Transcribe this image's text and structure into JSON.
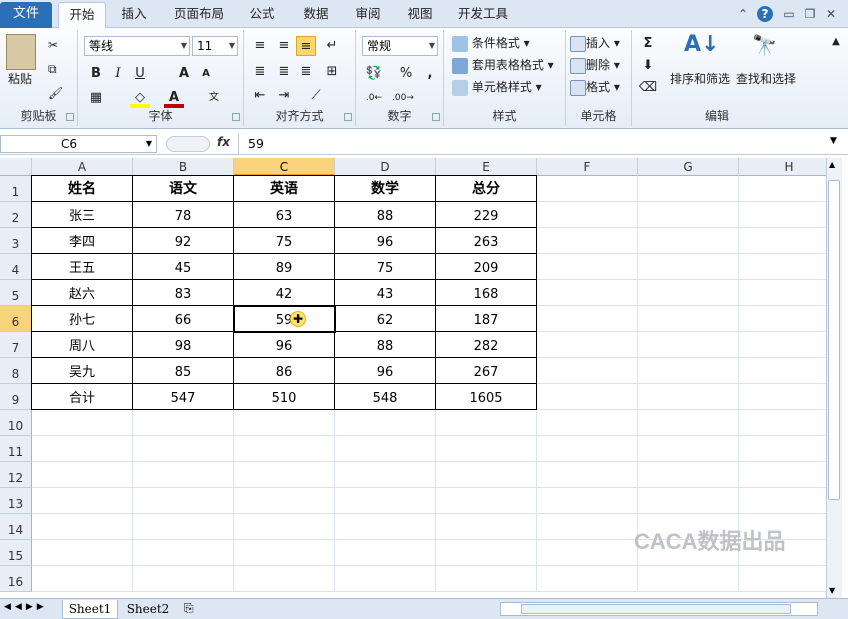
{
  "tabs": {
    "file": "文件",
    "items": [
      "开始",
      "插入",
      "页面布局",
      "公式",
      "数据",
      "审阅",
      "视图",
      "开发工具"
    ]
  },
  "ribbon": {
    "clipboard": {
      "paste": "粘贴",
      "label": "剪贴板"
    },
    "font": {
      "name": "等线",
      "size": "11",
      "label": "字体",
      "bold": "B",
      "italic": "I",
      "underline": "U",
      "grow": "A",
      "shrink": "A",
      "fill_color": "#ffff00",
      "font_color": "#c00000"
    },
    "alignment": {
      "label": "对齐方式"
    },
    "number": {
      "format": "常规",
      "label": "数字",
      "percent": "%",
      "comma": ","
    },
    "styles": {
      "conditional": "条件格式",
      "table": "套用表格格式",
      "cell": "单元格样式",
      "label": "样式"
    },
    "cells": {
      "insert": "插入",
      "delete": "删除",
      "format": "格式",
      "label": "单元格"
    },
    "editing": {
      "sort": "排序和筛选",
      "find": "查找和选择",
      "label": "编辑"
    }
  },
  "formula_bar": {
    "name_box": "C6",
    "fx": "fx",
    "value": "59"
  },
  "columns": [
    "A",
    "B",
    "C",
    "D",
    "E",
    "F",
    "G",
    "H"
  ],
  "selected_column": "C",
  "rows": [
    "1",
    "2",
    "3",
    "4",
    "5",
    "6",
    "7",
    "8",
    "9",
    "10",
    "11",
    "12",
    "13",
    "14",
    "15",
    "16"
  ],
  "selected_row": "6",
  "table": {
    "headers": [
      "姓名",
      "语文",
      "英语",
      "数学",
      "总分"
    ],
    "data": [
      [
        "张三",
        "78",
        "63",
        "88",
        "229"
      ],
      [
        "李四",
        "92",
        "75",
        "96",
        "263"
      ],
      [
        "王五",
        "45",
        "89",
        "75",
        "209"
      ],
      [
        "赵六",
        "83",
        "42",
        "43",
        "168"
      ],
      [
        "孙七",
        "66",
        "59",
        "62",
        "187"
      ],
      [
        "周八",
        "98",
        "96",
        "88",
        "282"
      ],
      [
        "吴九",
        "85",
        "86",
        "96",
        "267"
      ],
      [
        "合计",
        "547",
        "510",
        "548",
        "1605"
      ]
    ]
  },
  "sheets": [
    "Sheet1",
    "Sheet2"
  ],
  "watermark": "CACA数据出品"
}
